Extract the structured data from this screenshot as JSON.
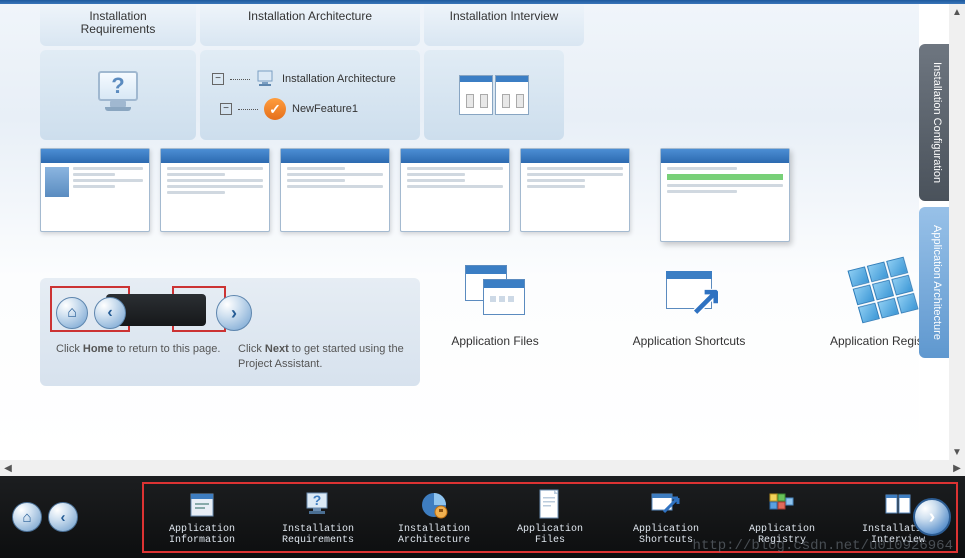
{
  "top_tabs": {
    "requirements": "Installation\nRequirements",
    "architecture": "Installation Architecture",
    "interview": "Installation Interview"
  },
  "arch_tree": {
    "root": "Installation Architecture",
    "child": "NewFeature1"
  },
  "nav_help": {
    "home_text_prefix": "Click ",
    "home_bold": "Home",
    "home_text_suffix": " to return to this page.",
    "next_text_prefix": "Click ",
    "next_bold": "Next",
    "next_text_suffix": " to get started using the Project Assistant."
  },
  "mid_apps": {
    "files": "Application Files",
    "shortcuts": "Application Shortcuts",
    "registry": "Application Registry"
  },
  "side_tabs": {
    "configuration": "Installation Configuration",
    "architecture": "Application Architecture"
  },
  "bottom_items": [
    {
      "key": "app-info",
      "label": "Application\nInformation"
    },
    {
      "key": "inst-req",
      "label": "Installation\nRequirements"
    },
    {
      "key": "inst-arch",
      "label": "Installation\nArchitecture"
    },
    {
      "key": "app-files",
      "label": "Application\nFiles"
    },
    {
      "key": "app-shortcuts",
      "label": "Application\nShortcuts"
    },
    {
      "key": "app-registry",
      "label": "Application\nRegistry"
    },
    {
      "key": "inst-interview",
      "label": "Installation\nInterview"
    }
  ],
  "watermark": "http://blog.csdn.net/u010926964"
}
